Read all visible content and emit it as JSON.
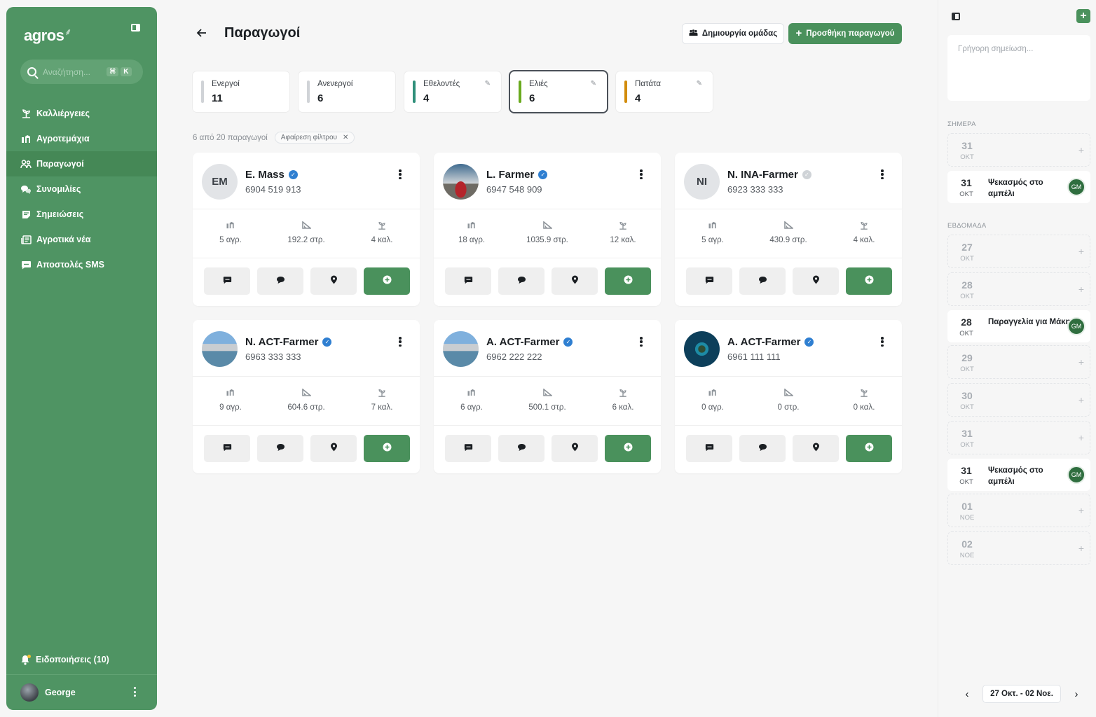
{
  "sidebar": {
    "logo": "agros",
    "search_placeholder": "Αναζήτηση...",
    "search_kbd": [
      "⌘",
      "K"
    ],
    "items": [
      {
        "label": "Καλλιέργειες",
        "icon": "crop-icon"
      },
      {
        "label": "Αγροτεμάχια",
        "icon": "field-icon"
      },
      {
        "label": "Παραγωγοί",
        "icon": "farmers-icon",
        "active": true
      },
      {
        "label": "Συνομιλίες",
        "icon": "chat-icon"
      },
      {
        "label": "Σημειώσεις",
        "icon": "notes-icon"
      },
      {
        "label": "Αγροτικά νέα",
        "icon": "news-icon"
      },
      {
        "label": "Αποστολές SMS",
        "icon": "sms-icon"
      }
    ],
    "notifications": "Ειδοποιήσεις (10)",
    "user": "George"
  },
  "header": {
    "title": "Παραγωγοί",
    "create_group": "Δημιουργία ομάδας",
    "add_farmer": "Προσθήκη παραγωγού"
  },
  "filters": [
    {
      "label": "Ενεργοί",
      "count": "11",
      "color": "#d0d3d7",
      "editable": false,
      "selected": false
    },
    {
      "label": "Ανενεργοί",
      "count": "6",
      "color": "#d0d3d7",
      "editable": false,
      "selected": false
    },
    {
      "label": "Εθελοντές",
      "count": "4",
      "color": "#2f8f7a",
      "editable": true,
      "selected": false
    },
    {
      "label": "Ελιές",
      "count": "6",
      "color": "#6aaa1f",
      "editable": true,
      "selected": true
    },
    {
      "label": "Πατάτα",
      "count": "4",
      "color": "#d28c0a",
      "editable": true,
      "selected": false
    }
  ],
  "results": {
    "summary": "6 από 20 παραγωγοί",
    "remove_filter": "Αφαίρεση φίλτρου"
  },
  "farmers": [
    {
      "name": "E. Mass",
      "initials": "EM",
      "phone": "6904 519 913",
      "verified": true,
      "avatar": "initials",
      "fields": "5 αγρ.",
      "area": "192.2 στρ.",
      "crops": "4 καλ."
    },
    {
      "name": "L. Farmer",
      "initials": "",
      "phone": "6947 548 909",
      "verified": true,
      "avatar": "car",
      "fields": "18 αγρ.",
      "area": "1035.9 στρ.",
      "crops": "12 καλ."
    },
    {
      "name": "N. INA-Farmer",
      "initials": "NI",
      "phone": "6923 333 333",
      "verified": false,
      "avatar": "initials",
      "fields": "5 αγρ.",
      "area": "430.9 στρ.",
      "crops": "4 καλ."
    },
    {
      "name": "N. ACT-Farmer",
      "initials": "",
      "phone": "6963 333 333",
      "verified": true,
      "avatar": "coast",
      "fields": "9 αγρ.",
      "area": "604.6 στρ.",
      "crops": "7 καλ."
    },
    {
      "name": "A. ACT-Farmer",
      "initials": "",
      "phone": "6962 222 222",
      "verified": true,
      "avatar": "coast",
      "fields": "6 αγρ.",
      "area": "500.1 στρ.",
      "crops": "6 καλ."
    },
    {
      "name": "A. ACT-Farmer",
      "initials": "",
      "phone": "6961 111 111",
      "verified": true,
      "avatar": "island",
      "fields": "0 αγρ.",
      "area": "0 στρ.",
      "crops": "0 καλ."
    }
  ],
  "panel": {
    "note_placeholder": "Γρήγορη σημείωση...",
    "today_label": "ΣΗΜΕΡΑ",
    "week_label": "ΕΒΔΟΜΑΔΑ",
    "today": [
      {
        "day": "31",
        "month": "ΟΚΤ",
        "type": "empty"
      },
      {
        "day": "31",
        "month": "ΟΚΤ",
        "type": "event",
        "title": "Ψεκασμός στο αμπέλι",
        "badge": "GM"
      }
    ],
    "week": [
      {
        "day": "27",
        "month": "ΟΚΤ",
        "type": "empty"
      },
      {
        "day": "28",
        "month": "ΟΚΤ",
        "type": "empty"
      },
      {
        "day": "28",
        "month": "ΟΚΤ",
        "type": "event",
        "title": "Παραγγελία για Μάκη",
        "badge": "GM"
      },
      {
        "day": "29",
        "month": "ΟΚΤ",
        "type": "empty"
      },
      {
        "day": "30",
        "month": "ΟΚΤ",
        "type": "empty"
      },
      {
        "day": "31",
        "month": "ΟΚΤ",
        "type": "empty"
      },
      {
        "day": "31",
        "month": "ΟΚΤ",
        "type": "event",
        "title": "Ψεκασμός στο αμπέλι",
        "badge": "GM"
      },
      {
        "day": "01",
        "month": "ΝΟΕ",
        "type": "empty"
      },
      {
        "day": "02",
        "month": "ΝΟΕ",
        "type": "empty"
      }
    ],
    "range": "27 Οκτ. - 02 Νοε."
  },
  "colors": {
    "brand": "#4f9463",
    "primary_button": "#4a915c",
    "verified": "#2f7fd1"
  }
}
